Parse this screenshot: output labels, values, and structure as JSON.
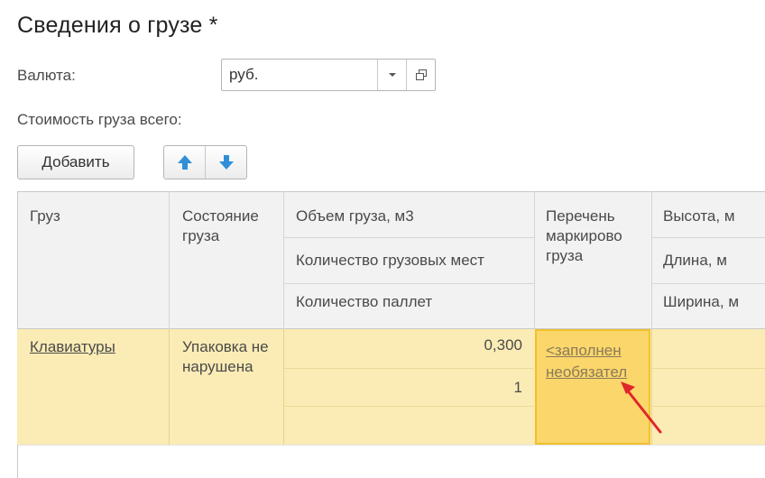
{
  "title": "Сведения о грузе *",
  "currency": {
    "label": "Валюта:",
    "value": "руб."
  },
  "total_cost": {
    "label": "Стоимость груза всего:"
  },
  "toolbar": {
    "add_label": "Добавить"
  },
  "icons": [
    "dropdown-arrow-icon",
    "open-form-icon",
    "arrow-up-icon",
    "arrow-down-icon"
  ],
  "colors": {
    "row_selected": "#fbecb5",
    "cell_active": "#fbd66b",
    "arrow": "#e0262a",
    "move_arrows": "#2f8fd8"
  },
  "table": {
    "headers": {
      "cargo": "Груз",
      "state": "Состояние груза",
      "volume": "Объем груза, м3",
      "places": "Количество грузовых мест",
      "pallets": "Количество паллет",
      "marking": "Перечень маркирово груза",
      "height": "Высота, м",
      "length": "Длина, м",
      "width": "Ширина, м"
    },
    "rows": [
      {
        "cargo": "Клавиатуры",
        "state": "Упаковка не нарушена",
        "volume": "0,300",
        "places": "1",
        "pallets": "",
        "marking_line1": "<заполнен",
        "marking_line2": "необязател"
      }
    ]
  }
}
